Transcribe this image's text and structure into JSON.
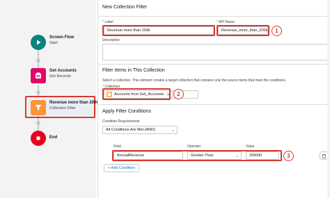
{
  "canvas": {
    "nodes": [
      {
        "title": "Screen Flow",
        "subtitle": "Start",
        "icon": "play-icon",
        "color": "#0b827c"
      },
      {
        "title": "Get Accounts",
        "subtitle": "Get Records",
        "icon": "records-icon",
        "color": "#e3066a"
      },
      {
        "title": "Revenue more than 200k",
        "subtitle": "Collection Filter",
        "icon": "filter-icon",
        "color": "#fe9339"
      },
      {
        "title": "End",
        "subtitle": "",
        "icon": "stop-icon",
        "color": "#ea001e"
      }
    ]
  },
  "panel": {
    "title": "New Collection Filter",
    "label_field": {
      "label": "Label",
      "value": "Revenue more than 200k"
    },
    "api_field": {
      "label": "API Name",
      "value": "Revenue_more_than_200k"
    },
    "description": {
      "label": "Description",
      "value": ""
    },
    "filter_section": {
      "title": "Filter Items in This Collection",
      "help": "Select a collection. This element creates a target collection that contains only the source items that meet the conditions.",
      "collection_label": "Collection",
      "collection_value": "Accounts from Get_Accounts"
    },
    "conditions_section": {
      "title": "Apply Filter Conditions",
      "requirements_label": "Condition Requirements",
      "requirements_value": "All Conditions Are Met (AND)",
      "field_label": "Field",
      "field_value": "AnnualRevenue",
      "operator_label": "Operator",
      "operator_value": "Greater Than",
      "value_label": "Value",
      "value_value": "200000",
      "add_condition": "+ Add Condition"
    },
    "badges": [
      "1",
      "2",
      "3"
    ]
  },
  "colors": {
    "annotation": "#d63831",
    "link": "#0176d3"
  }
}
